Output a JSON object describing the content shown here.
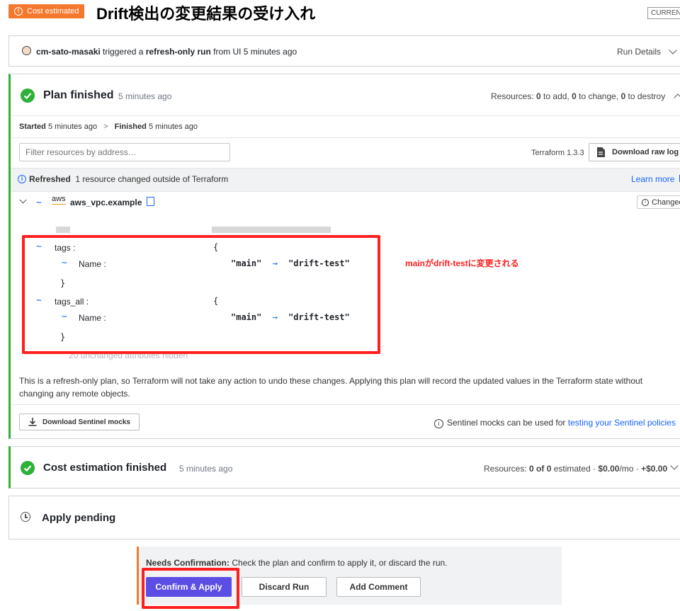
{
  "header": {
    "badge": "Cost estimated",
    "title": "Drift検出の変更結果の受け入れ",
    "current_label": "CURREN"
  },
  "trigger": {
    "user": "cm-sato-masaki",
    "text1": " triggered a ",
    "run_type": "refresh-only run",
    "text2": " from UI 5 minutes ago",
    "details_label": "Run Details"
  },
  "plan": {
    "title": "Plan finished",
    "time": "5 minutes ago",
    "resources_prefix": "Resources: ",
    "add": "0",
    "add_label": " to add, ",
    "change": "0",
    "change_label": " to change, ",
    "destroy": "0",
    "destroy_label": " to destroy",
    "started_label": "Started",
    "started_time": "5 minutes ago",
    "finished_label": "Finished",
    "finished_time": "5 minutes ago",
    "filter_placeholder": "Filter resources by address…",
    "terraform_version": "Terraform 1.3.3",
    "download_log": "Download raw log",
    "refreshed_label": "Refreshed",
    "refreshed_text": "1 resource changed outside of Terraform",
    "learn_more": "Learn more",
    "resource_name": "aws_vpc.example",
    "aws_logo": "aws",
    "changed_badge": "Changed",
    "diff": {
      "tags_key": "tags :",
      "tags_all_key": "tags_all :",
      "name_key": "Name :",
      "open_brace": "{",
      "close_brace": "}",
      "old_value": "\"main\"",
      "arrow": "→",
      "new_value": "\"drift-test\"",
      "hidden_attrs": "20 unchanged attributes hidden"
    },
    "annotation": "mainがdrift-testに変更される",
    "notice": "This is a refresh-only plan, so Terraform will not take any action to undo these changes. Applying this plan will record the updated values in the Terraform state without changing any remote objects.",
    "sentinel_button": "Download Sentinel mocks",
    "sentinel_text": "Sentinel mocks can be used for ",
    "sentinel_link": "testing your Sentinel policies"
  },
  "cost": {
    "title": "Cost estimation finished",
    "time": "5 minutes ago",
    "resources_prefix": "Resources: ",
    "count": "0 of 0",
    "estimated_label": " estimated · ",
    "monthly": "$0.00",
    "per_mo": "/mo · ",
    "delta": "+$0.00"
  },
  "apply": {
    "title": "Apply pending"
  },
  "confirm": {
    "label": "Needs Confirmation:",
    "text": " Check the plan and confirm to apply it, or discard the run.",
    "confirm_button": "Confirm & Apply",
    "discard_button": "Discard Run",
    "comment_button": "Add Comment"
  }
}
